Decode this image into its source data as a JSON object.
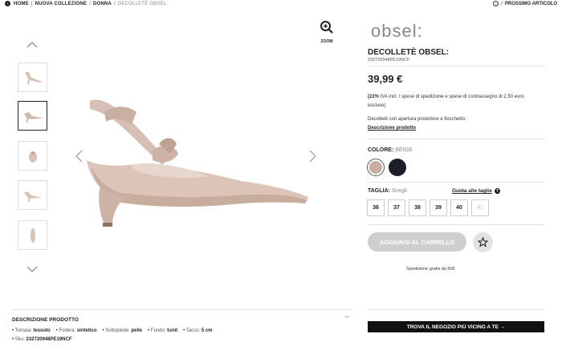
{
  "breadcrumb": {
    "items": [
      "HOME",
      "NUOVA COLLEZIONE",
      "DONNA"
    ],
    "current": "DECOLLETÈ OBSEL:"
  },
  "next_article": {
    "label": "PROSSIMO ARTICOLO"
  },
  "gallery": {
    "zoom_label": "ZOOM",
    "thumbnails": 5,
    "active_thumbnail": 2
  },
  "brand": {
    "logo_text": "obsel:"
  },
  "product": {
    "name": "DECOLLETÈ OBSEL:",
    "sku": "232720948PE19NCF",
    "price": "39,99 €",
    "vat_note_bold": "(22%",
    "vat_note": "IVA incl. / spese di spedizione e spese di contrassegno di 2.50 euro escluse)",
    "description": "Decolletè con apertura posteriore e fiocchetto.",
    "description_link": "Descrizione prodotto"
  },
  "color": {
    "label": "COLORE:",
    "value": "BEIGE",
    "swatches": [
      "#c9ada3",
      "#1c1e2a"
    ]
  },
  "size": {
    "label": "TAGLIA:",
    "placeholder": "Scegli",
    "guide": "Guida alle taglie",
    "options": [
      {
        "label": "36",
        "available": true
      },
      {
        "label": "37",
        "available": true
      },
      {
        "label": "38",
        "available": true
      },
      {
        "label": "39",
        "available": true
      },
      {
        "label": "40",
        "available": true
      },
      {
        "label": "41",
        "available": false
      }
    ]
  },
  "actions": {
    "add_to_cart": "AGGIUNGI AL CARRELLO",
    "shipping_note": "Spedizione gratis da 50€",
    "find_store": "TROVA IL NEGOZIO PIÙ VICINO A TE →"
  },
  "details": {
    "title": "DESCRIZIONE PRODOTTO",
    "toggle": "–",
    "attributes": [
      {
        "key": "Tomaia:",
        "value": "tessuto"
      },
      {
        "key": "Fodera:",
        "value": "sintetico"
      },
      {
        "key": "Sottopiede:",
        "value": "pelle"
      },
      {
        "key": "Fondo:",
        "value": "tunit"
      },
      {
        "key": "Tacco:",
        "value": "5 cm"
      }
    ],
    "sku_label": "Sku:",
    "sku": "232720948PE19NCF"
  }
}
